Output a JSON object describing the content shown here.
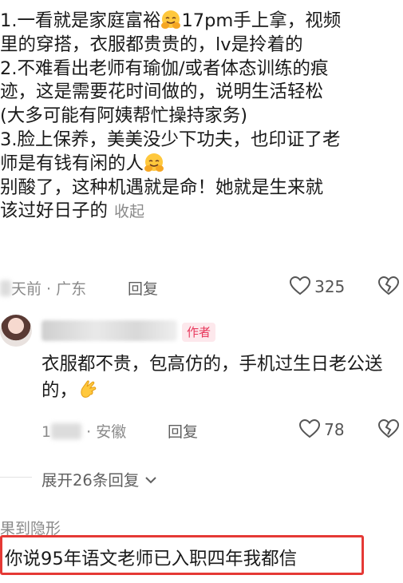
{
  "comment": {
    "lines": [
      "1.一看就是家庭富裕",
      "17pm手上拿，视频",
      "里的穿搭，衣服都贵贵的，lv是拎着的",
      "2.不难看出老师有瑜伽/或者体态训练的痕",
      "迹，这是需要花时间做的，说明生活轻松",
      "(大多可能有阿姨帮忙操持家务)",
      "3.脸上保养，美美没少下功夫，也印证了老",
      "师是有钱有闲的人",
      "别酸了，这种机遇就是命！她就是生来就",
      "该过好日子的"
    ],
    "collapse_label": "收起",
    "time_location": "天前 · 广东",
    "reply_label": "回复",
    "like_count": "325",
    "emoji_icon": "hugging-face-emoji"
  },
  "reply": {
    "author_badge": "作者",
    "text": "衣服都不贵，包高仿的，手机过生日老公送的，",
    "time_location": "· 安徽",
    "time_prefix": "1",
    "reply_label": "回复",
    "like_count": "78",
    "emoji_icon": "ok-hand-emoji"
  },
  "expand_label": "展开26条回复",
  "next_comment": {
    "username": "果到隐形",
    "text": "你说95年语文老师已入职四年我都信"
  },
  "colors": {
    "author_badge_text": "#e8385c",
    "author_badge_bg": "#fde8ec",
    "highlight_border": "#e53935"
  }
}
